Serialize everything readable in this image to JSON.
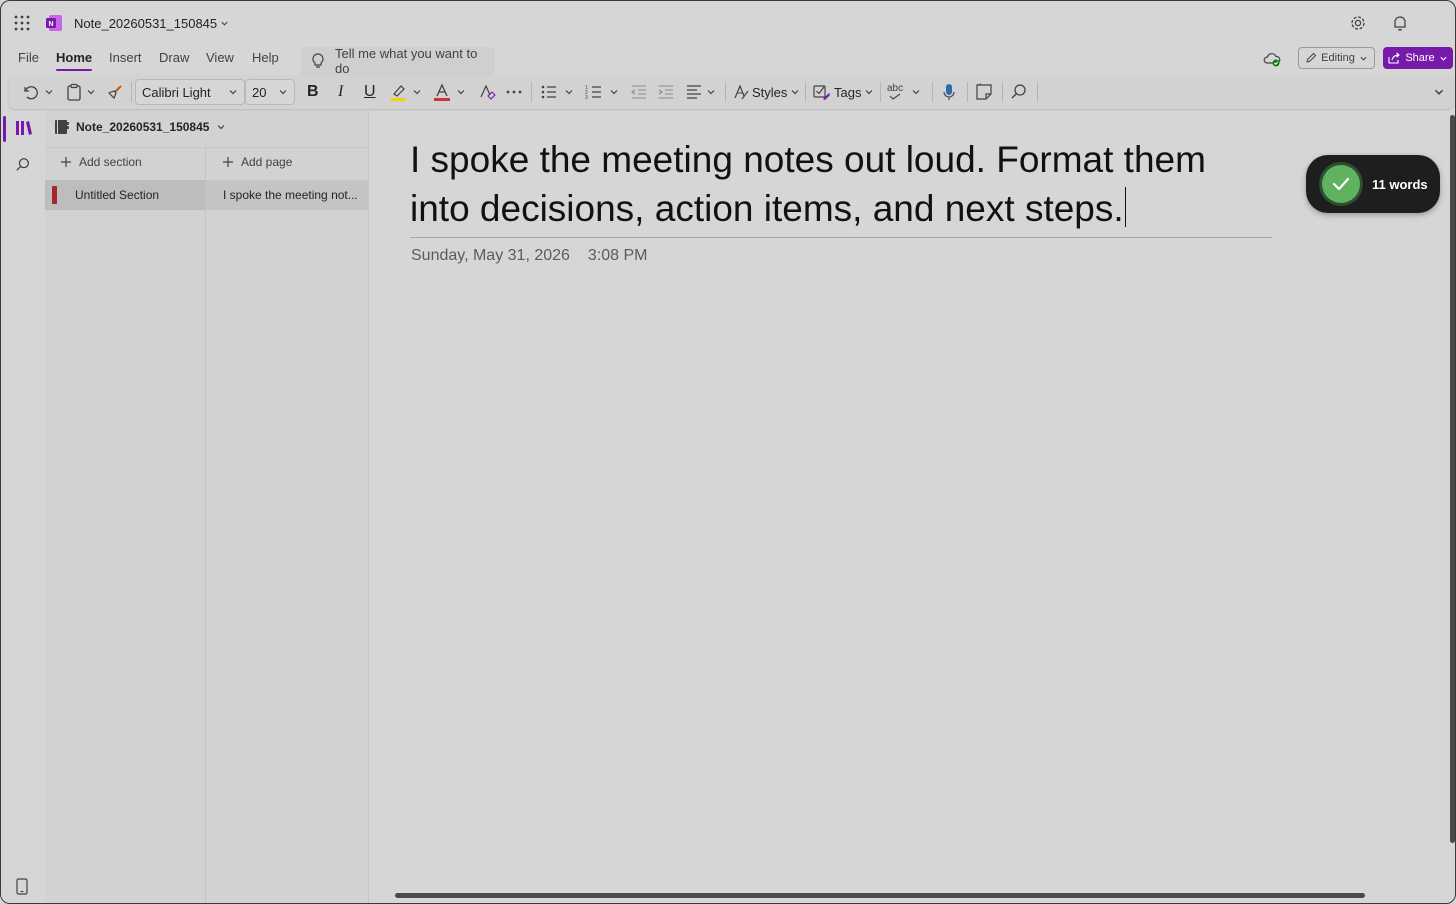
{
  "window": {
    "doc_title": "Note_20260531_150845"
  },
  "menu": {
    "tabs": [
      {
        "label": "File"
      },
      {
        "label": "Home",
        "active": true
      },
      {
        "label": "Insert"
      },
      {
        "label": "Draw"
      },
      {
        "label": "View"
      },
      {
        "label": "Help"
      }
    ],
    "tell_me": "Tell me what you want to do",
    "editing_label": "Editing",
    "share_label": "Share"
  },
  "ribbon": {
    "font_name": "Calibri Light",
    "font_size": "20",
    "styles_label": "Styles",
    "tags_label": "Tags",
    "spell_label": "abc",
    "highlight_color": "#f3d200",
    "font_color": "#d13438"
  },
  "navigation": {
    "notebook_name": "Note_20260531_150845",
    "add_section_label": "Add section",
    "add_page_label": "Add page",
    "sections": [
      {
        "label": "Untitled Section",
        "color": "#a4262c"
      }
    ],
    "pages": [
      {
        "label": "I spoke the meeting not..."
      }
    ]
  },
  "page": {
    "title": "I spoke the meeting notes out loud. Format them into decisions, action items, and next steps.",
    "date": "Sunday, May 31, 2026",
    "time": "3:08 PM"
  },
  "word_count_badge": {
    "label": "11 words"
  },
  "colors": {
    "accent": "#7719aa",
    "badge_check": "#5fb35f"
  }
}
